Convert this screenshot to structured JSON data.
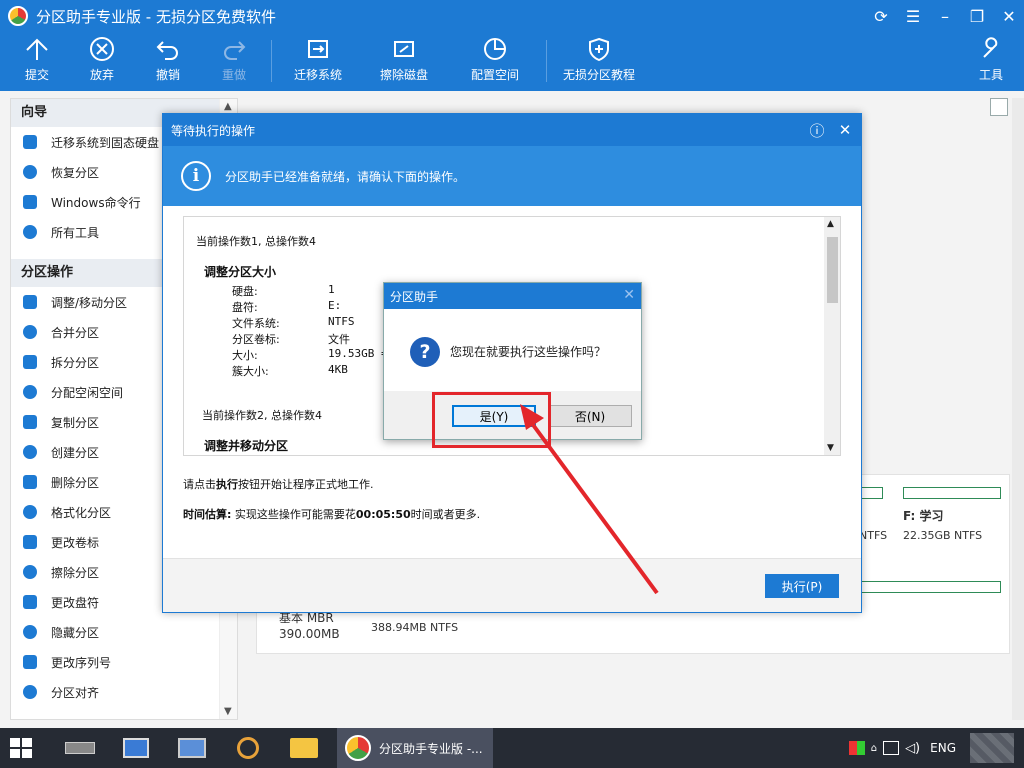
{
  "window": {
    "title": "分区助手专业版 - 无损分区免费软件",
    "controls": [
      "refresh-icon",
      "menu-icon",
      "minimize-icon",
      "restore-icon",
      "close-icon"
    ]
  },
  "toolbar": {
    "commit": "提交",
    "discard": "放弃",
    "undo": "撤销",
    "redo": "重做",
    "migrate": "迁移系统",
    "wipe": "擦除磁盘",
    "allocate": "配置空间",
    "tutorial": "无损分区教程",
    "tools": "工具"
  },
  "sidebar": {
    "wizard_header": "向导",
    "wizard_items": [
      {
        "label": "迁移系统到固态硬盘",
        "icon": "migrate-ssd-icon"
      },
      {
        "label": "恢复分区",
        "icon": "recover-icon"
      },
      {
        "label": "Windows命令行",
        "icon": "windows-icon"
      },
      {
        "label": "所有工具",
        "icon": "grid-icon"
      }
    ],
    "ops_header": "分区操作",
    "ops_items": [
      {
        "label": "调整/移动分区",
        "icon": "resize-icon"
      },
      {
        "label": "合并分区",
        "icon": "merge-icon"
      },
      {
        "label": "拆分分区",
        "icon": "split-icon"
      },
      {
        "label": "分配空闲空间",
        "icon": "allocate-icon"
      },
      {
        "label": "复制分区",
        "icon": "copy-icon"
      },
      {
        "label": "创建分区",
        "icon": "create-icon"
      },
      {
        "label": "删除分区",
        "icon": "delete-icon"
      },
      {
        "label": "格式化分区",
        "icon": "format-icon"
      },
      {
        "label": "更改卷标",
        "icon": "label-icon"
      },
      {
        "label": "擦除分区",
        "icon": "wipe-icon"
      },
      {
        "label": "更改盘符",
        "icon": "letter-icon"
      },
      {
        "label": "隐藏分区",
        "icon": "hide-icon"
      },
      {
        "label": "更改序列号",
        "icon": "serial-icon"
      },
      {
        "label": "分区对齐",
        "icon": "align-icon"
      }
    ]
  },
  "main": {
    "partitions": [
      {
        "name": "F: 学习",
        "info": "22.35GB NTFS"
      },
      {
        "name": "",
        "info": "NTFS"
      }
    ],
    "disk_info": {
      "type": "基本 MBR",
      "size": "390.00MB",
      "partition_info": "388.94MB NTFS"
    }
  },
  "pending_dialog": {
    "title": "等待执行的操作",
    "banner": "分区助手已经准备就绪，请确认下面的操作。",
    "op1_header": "当前操作数1, 总操作数4",
    "op1_title": "调整分区大小",
    "op1_fields": [
      {
        "key": "硬盘:",
        "value": "1"
      },
      {
        "key": "盘符:",
        "value": "E:"
      },
      {
        "key": "文件系统:",
        "value": "NTFS"
      },
      {
        "key": "分区卷标:",
        "value": "文件"
      },
      {
        "key": "大小:",
        "value": "19.53GB ="
      },
      {
        "key": "簇大小:",
        "value": "4KB"
      }
    ],
    "op2_header": "当前操作数2, 总操作数4",
    "op2_title": "调整并移动分区",
    "note_prefix": "请点击",
    "note_bold": "执行",
    "note_suffix": "按钮开始让程序正式地工作.",
    "time_label": "时间估算:",
    "time_prefix": " 实现这些操作可能需要花",
    "time_value": "00:05:50",
    "time_suffix": "时间或者更多.",
    "execute_button": "执行(P)"
  },
  "confirm_dialog": {
    "title": "分区助手",
    "message": "您现在就要执行这些操作吗？",
    "yes": "是(Y)",
    "no": "否(N)"
  },
  "taskbar": {
    "active_app": "分区助手专业版 -...",
    "language": "ENG"
  },
  "colors": {
    "accent": "#1d7ad3",
    "banner": "#2e8ddf",
    "highlight": "#e3262b"
  }
}
